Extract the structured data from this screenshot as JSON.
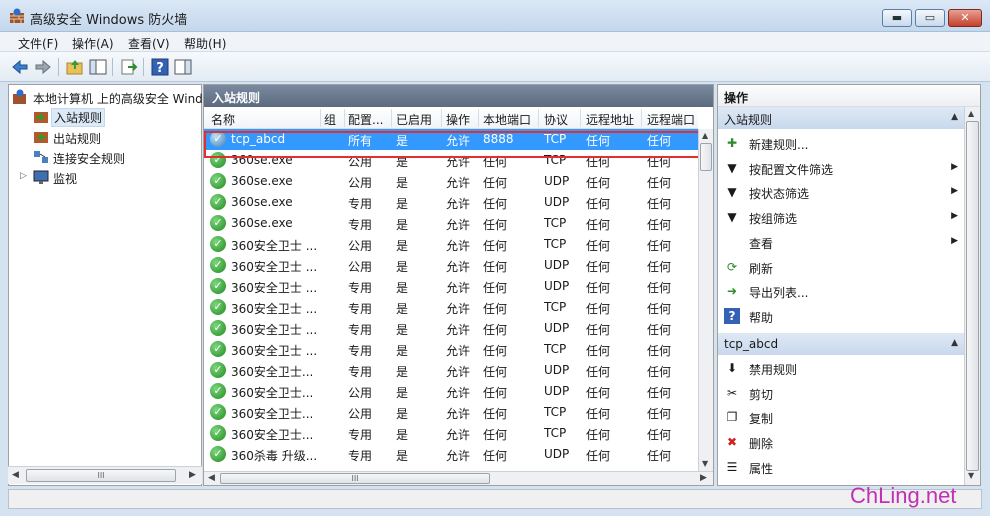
{
  "window": {
    "title": "高级安全 Windows 防火墙",
    "min_glyph": "▬",
    "max_glyph": "▭",
    "close_glyph": "✕"
  },
  "menu": [
    {
      "label": "文件(F)"
    },
    {
      "label": "操作(A)"
    },
    {
      "label": "查看(V)"
    },
    {
      "label": "帮助(H)"
    }
  ],
  "toolbar": {
    "buttons": [
      "back-icon",
      "forward-icon",
      "up-folder-icon",
      "show-hide-tree-icon",
      "export-icon",
      "help-icon",
      "show-hide-action-pane-icon"
    ]
  },
  "tree": {
    "root": "本地计算机 上的高级安全 Windows",
    "items": [
      {
        "label": "入站规则",
        "icon": "inbound-rules-icon",
        "selected": true
      },
      {
        "label": "出站规则",
        "icon": "outbound-rules-icon"
      },
      {
        "label": "连接安全规则",
        "icon": "connection-security-icon"
      },
      {
        "label": "监视",
        "icon": "monitor-icon",
        "expandable": true
      }
    ]
  },
  "center": {
    "header": "入站规则",
    "columns": [
      "名称",
      "组",
      "配置...",
      "已启用",
      "操作",
      "本地端口",
      "协议",
      "远程地址",
      "远程端口"
    ],
    "rows": [
      [
        "tcp_abcd",
        "",
        "所有",
        "是",
        "允许",
        "8888",
        "TCP",
        "任何",
        "任何"
      ],
      [
        "360se.exe",
        "",
        "公用",
        "是",
        "允许",
        "任何",
        "TCP",
        "任何",
        "任何"
      ],
      [
        "360se.exe",
        "",
        "公用",
        "是",
        "允许",
        "任何",
        "UDP",
        "任何",
        "任何"
      ],
      [
        "360se.exe",
        "",
        "专用",
        "是",
        "允许",
        "任何",
        "UDP",
        "任何",
        "任何"
      ],
      [
        "360se.exe",
        "",
        "专用",
        "是",
        "允许",
        "任何",
        "TCP",
        "任何",
        "任何"
      ],
      [
        "360安全卫士 ...",
        "",
        "公用",
        "是",
        "允许",
        "任何",
        "TCP",
        "任何",
        "任何"
      ],
      [
        "360安全卫士 ...",
        "",
        "公用",
        "是",
        "允许",
        "任何",
        "UDP",
        "任何",
        "任何"
      ],
      [
        "360安全卫士 ...",
        "",
        "专用",
        "是",
        "允许",
        "任何",
        "UDP",
        "任何",
        "任何"
      ],
      [
        "360安全卫士 ...",
        "",
        "专用",
        "是",
        "允许",
        "任何",
        "TCP",
        "任何",
        "任何"
      ],
      [
        "360安全卫士 ...",
        "",
        "专用",
        "是",
        "允许",
        "任何",
        "UDP",
        "任何",
        "任何"
      ],
      [
        "360安全卫士 ...",
        "",
        "专用",
        "是",
        "允许",
        "任何",
        "TCP",
        "任何",
        "任何"
      ],
      [
        "360安全卫士...",
        "",
        "专用",
        "是",
        "允许",
        "任何",
        "UDP",
        "任何",
        "任何"
      ],
      [
        "360安全卫士...",
        "",
        "公用",
        "是",
        "允许",
        "任何",
        "UDP",
        "任何",
        "任何"
      ],
      [
        "360安全卫士...",
        "",
        "公用",
        "是",
        "允许",
        "任何",
        "TCP",
        "任何",
        "任何"
      ],
      [
        "360安全卫士...",
        "",
        "专用",
        "是",
        "允许",
        "任何",
        "TCP",
        "任何",
        "任何"
      ],
      [
        "360杀毒 升级...",
        "",
        "专用",
        "是",
        "允许",
        "任何",
        "UDP",
        "任何",
        "任何"
      ]
    ],
    "scroll_glyph": "III"
  },
  "actions": {
    "title": "操作",
    "group1": "入站规则",
    "group1_items": [
      {
        "label": "新建规则...",
        "icon": "new-rule-icon",
        "glyph": "✚"
      },
      {
        "label": "按配置文件筛选",
        "icon": "filter-icon",
        "glyph": "▼",
        "submenu": true
      },
      {
        "label": "按状态筛选",
        "icon": "filter-icon",
        "glyph": "▼",
        "submenu": true
      },
      {
        "label": "按组筛选",
        "icon": "filter-icon",
        "glyph": "▼",
        "submenu": true
      },
      {
        "label": "查看",
        "icon": "",
        "glyph": "",
        "submenu": true
      },
      {
        "label": "刷新",
        "icon": "refresh-icon",
        "glyph": "⟳"
      },
      {
        "label": "导出列表...",
        "icon": "export-list-icon",
        "glyph": "➜"
      },
      {
        "label": "帮助",
        "icon": "help-icon",
        "glyph": "?"
      }
    ],
    "group2": "tcp_abcd",
    "group2_items": [
      {
        "label": "禁用规则",
        "icon": "disable-rule-icon",
        "glyph": "⬇"
      },
      {
        "label": "剪切",
        "icon": "cut-icon",
        "glyph": "✂"
      },
      {
        "label": "复制",
        "icon": "copy-icon",
        "glyph": "❐"
      },
      {
        "label": "删除",
        "icon": "delete-icon",
        "glyph": "✖"
      },
      {
        "label": "属性",
        "icon": "properties-icon",
        "glyph": "☰"
      }
    ]
  },
  "watermark": "ChLing.net",
  "colors": {
    "selection": "#3399ff",
    "highlight_box": "#e03030",
    "watermark": "#c22fb4",
    "allow_icon": "#1f8a1f"
  }
}
